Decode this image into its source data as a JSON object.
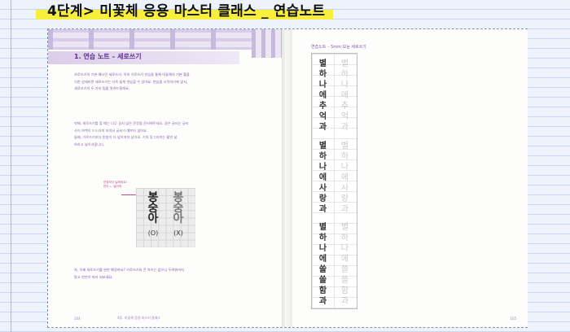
{
  "header": {
    "title": "4단계> 미꽃체 응용 마스터 클래스 _ 연습노트"
  },
  "left_page": {
    "section_title": "1. 연습 노트 – 세로쓰기",
    "intro": [
      "가로쓰기의 기본 예시인 세로쓰기. 이미 가로쓰기 연습을 통해 미꽃체의 기본 틀을",
      "익힌 상태라면 세로쓰기는 더욱 쉽게 연습할 수 있어요. 연습을 시작하기에 앞서,",
      "세로쓰기의 두 가지 팁을 알려드릴게요."
    ],
    "tips": [
      "첫째, 세로쓰기를 할 때는 너무 길지 않은 문장을 준비해주세요. 같은 글씨는 글씨",
      "사이 여백이 드드러져 보여서 글씨가 예쁘지 않아요.",
      "둘째, 가로쓰기보다 받침이 더 넓어져야 남아요. 기의 동그라미는 활연 넓",
      "하하고 넓히셔줍니다."
    ],
    "callout": [
      "받침보다 넓게써요!",
      "받아 ㄴ 넓어져"
    ],
    "demo": {
      "good": {
        "chars": [
          "봉",
          "숭",
          "아"
        ],
        "mark": "(O)"
      },
      "bad": {
        "chars": [
          "봉",
          "숭",
          "아"
        ],
        "mark": "(X)"
      }
    },
    "closing": [
      "자, 이제 세로쓰기를 완한 예정하요? 가로쓰기와 큰 차이는 없으니 두려워하지",
      "말고 천천히 따라 써보세요."
    ],
    "footer_page": "104",
    "footer_title": "4장. 미꽃체 응용 마스터 클래스"
  },
  "right_page": {
    "header": "연습노트 – 5mm 모눈 세로쓰기",
    "lines": [
      [
        "별"
      ],
      [
        "하",
        "나",
        "에"
      ],
      [
        "추",
        "억",
        "과"
      ],
      [
        "별"
      ],
      [
        "하",
        "나",
        "에"
      ],
      [
        "사",
        "랑",
        "과"
      ],
      [
        "별"
      ],
      [
        "하",
        "나",
        "에"
      ],
      [
        "쓸",
        "쓸",
        "함",
        "과"
      ]
    ],
    "footer_page": "105"
  }
}
